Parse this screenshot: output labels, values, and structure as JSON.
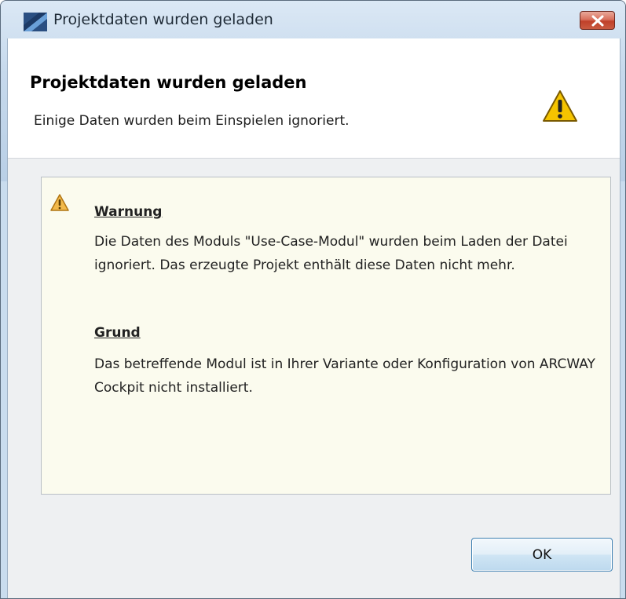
{
  "window": {
    "title": "Projektdaten wurden geladen",
    "close_icon": "close-icon",
    "app_icon": "app-icon"
  },
  "banner": {
    "title": "Projektdaten wurden geladen",
    "subtitle": "Einige Daten wurden beim Einspielen ignoriert.",
    "icon": "warning-icon"
  },
  "message": {
    "icon": "warning-icon",
    "heading": "Warnung",
    "body": "Die Daten des Moduls \"Use-Case-Modul\" wurden beim Laden der Datei ignoriert. Das erzeugte Projekt enthält diese Daten nicht mehr.",
    "reason_heading": "Grund",
    "reason_body": "Das betreffende Modul ist in Ihrer Variante oder Konfiguration von ARCWAY Cockpit nicht installiert."
  },
  "buttons": {
    "ok_label": "OK"
  },
  "colors": {
    "frame": "#c6d9ec",
    "message_background": "#fbfbee",
    "close_button": "#c95a40",
    "warning_yellow": "#f5c400"
  }
}
